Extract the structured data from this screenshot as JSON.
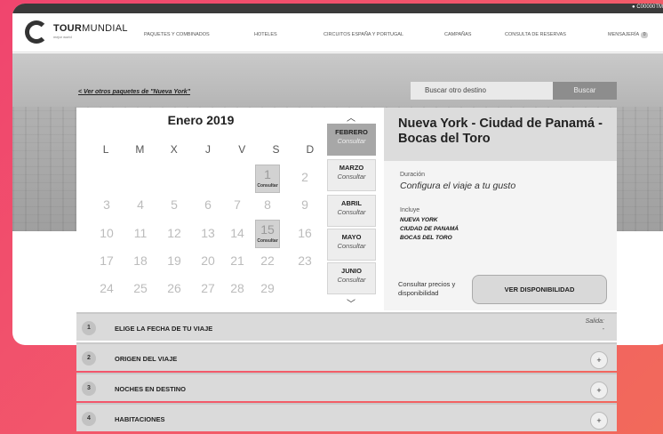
{
  "user": {
    "label": "C00000TM"
  },
  "logo": {
    "brand_bold": "TOUR",
    "brand_thin": "MUNDIAL",
    "tagline": "mejor world"
  },
  "nav": {
    "items": [
      "PAQUETES Y COMBINADOS",
      "HOTELES",
      "CIRCUITOS ESPAÑA Y PORTUGAL",
      "CAMPAÑAS",
      "CONSULTA DE RESERVAS",
      "MENSAJERÍA"
    ],
    "badge": "0"
  },
  "back_link": "<  Ver otros paquetes de \"Nueva York\"",
  "search": {
    "placeholder": "Buscar otro destino",
    "button": "Buscar"
  },
  "calendar": {
    "title": "Enero 2019",
    "weekdays": [
      "L",
      "M",
      "X",
      "J",
      "V",
      "S",
      "D"
    ],
    "days": {
      "d1": "1",
      "d2": "2",
      "d3": "3",
      "d4": "4",
      "d5": "5",
      "d6": "6",
      "d7": "7",
      "d8": "8",
      "d9": "9",
      "d10": "10",
      "d11": "11",
      "d12": "12",
      "d13": "13",
      "d14": "14",
      "d15": "15",
      "d16": "16",
      "d17": "17",
      "d18": "18",
      "d19": "19",
      "d20": "20",
      "d21": "21",
      "d22": "22",
      "d23": "23",
      "d24": "24",
      "d25": "25",
      "d26": "26",
      "d27": "27",
      "d28": "28",
      "d29": "29"
    },
    "consult_label": "Consultar",
    "months": [
      {
        "name": "FEBRERO",
        "sub": "Consultar"
      },
      {
        "name": "MARZO",
        "sub": "Consultar"
      },
      {
        "name": "ABRIL",
        "sub": "Consultar"
      },
      {
        "name": "MAYO",
        "sub": "Consultar"
      },
      {
        "name": "JUNIO",
        "sub": "Consultar"
      }
    ]
  },
  "info": {
    "title": "Nueva York - Ciudad de Panamá - Bocas del Toro",
    "duration_label": "Duración",
    "duration_value": "Configura el viaje a tu gusto",
    "includes_label": "Incluye",
    "destinations": [
      "NUEVA YORK",
      "CIUDAD DE PANAMÁ",
      "BOCAS DEL TORO"
    ],
    "consult_text": "Consultar precios y disponibilidad",
    "availability_button": "VER DISPONIBILIDAD"
  },
  "steps": [
    {
      "num": "1",
      "label": "ELIGE LA FECHA DE TU VIAJE",
      "extra": "Salida:",
      "extra2": "-"
    },
    {
      "num": "2",
      "label": "ORIGEN DEL VIAJE",
      "action": "+"
    },
    {
      "num": "3",
      "label": "NOCHES EN DESTINO",
      "action": "+"
    },
    {
      "num": "4",
      "label": "HABITACIONES",
      "action": "+"
    }
  ]
}
